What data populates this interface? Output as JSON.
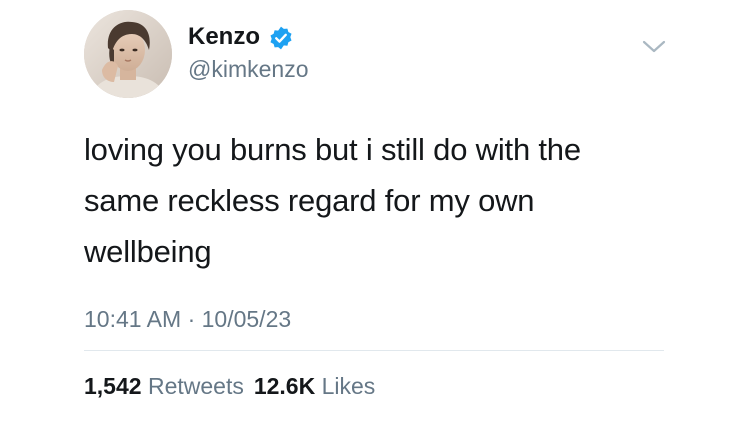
{
  "user": {
    "display_name": "Kenzo",
    "handle": "@kimkenzo",
    "verified": true
  },
  "tweet": {
    "text_lines": [
      "loving you burns but i still do with the",
      "same reckless regard for my own",
      "wellbeing"
    ],
    "timestamp": "10:41 AM · 10/05/23"
  },
  "stats": {
    "retweets_count": "1,542",
    "retweets_label": "Retweets",
    "likes_count": "12.6K",
    "likes_label": "Likes"
  },
  "icons": {
    "verified": "verified-badge-icon",
    "menu": "chevron-down-icon"
  },
  "colors": {
    "verified_blue": "#1da1f2",
    "text": "#14171a",
    "muted": "#657786",
    "divider": "#e1e8ed"
  }
}
